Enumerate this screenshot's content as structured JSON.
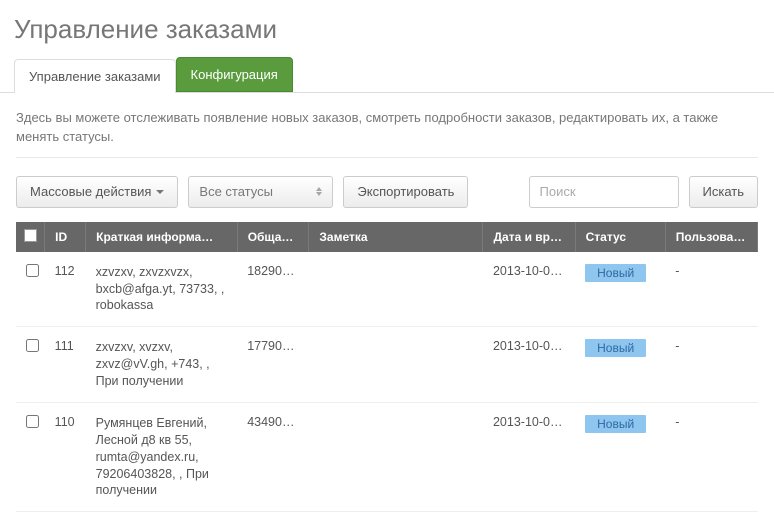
{
  "page_title": "Управление заказами",
  "tabs": [
    {
      "label": "Управление заказами",
      "active": true
    },
    {
      "label": "Конфигурация",
      "green": true
    }
  ],
  "intro": "Здесь вы можете отслеживать появление новых заказов, смотреть подробности заказов, редактировать их, а также менять статусы.",
  "toolbar": {
    "bulk_label": "Массовые действия",
    "status_filter_label": "Все статусы",
    "export_label": "Экспортировать",
    "search_placeholder": "Поиск",
    "search_button_label": "Искать"
  },
  "columns": {
    "id": "ID",
    "info": "Краткая информа…",
    "total": "Обща…",
    "note": "Заметка",
    "date": "Дата и вр…",
    "status": "Статус",
    "user": "Пользовате…"
  },
  "rows": [
    {
      "id": "112",
      "info": "xzvzxv, zxvzxvzx, bxcb@afga.yt, 73733, , robokassa",
      "total": "18290…",
      "note": "",
      "date": "2013-10-0…",
      "status": "Новый",
      "user": "-"
    },
    {
      "id": "111",
      "info": "zxvzxv, xvzxv, zxvz@vV.gh, +743, , При получении",
      "total": "17790…",
      "note": "",
      "date": "2013-10-0…",
      "status": "Новый",
      "user": "-"
    },
    {
      "id": "110",
      "info": "Румянцев Евгений, Лесной д8 кв 55, rumta@yandex.ru, 79206403828, , При получении",
      "total": "43490…",
      "note": "",
      "date": "2013-10-0…",
      "status": "Новый",
      "user": "-"
    }
  ]
}
